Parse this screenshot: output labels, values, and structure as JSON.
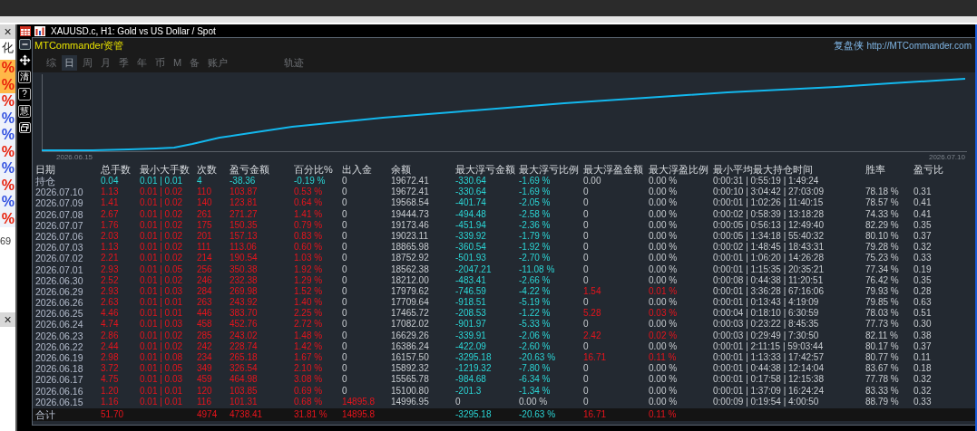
{
  "left_panel": {
    "close": "×",
    "label": "化",
    "items": [
      {
        "text": "%",
        "color": "#e8200a",
        "highlight": true
      },
      {
        "text": "%",
        "color": "#e8200a",
        "highlight": true
      },
      {
        "text": "%",
        "color": "#e8200a",
        "highlight": false
      },
      {
        "text": "%",
        "color": "#3050e0",
        "highlight": false
      },
      {
        "text": "%",
        "color": "#3050e0",
        "highlight": false
      },
      {
        "text": "%",
        "color": "#e8200a",
        "highlight": false
      },
      {
        "text": "%",
        "color": "#3050e0",
        "highlight": false
      },
      {
        "text": "%",
        "color": "#e8200a",
        "highlight": false
      },
      {
        "text": "%",
        "color": "#3050e0",
        "highlight": false
      },
      {
        "text": "%",
        "color": "#e8200a",
        "highlight": false
      }
    ],
    "value": "69",
    "close_2": "×"
  },
  "tools": [
    {
      "kind": "minus"
    },
    {
      "kind": "move"
    },
    {
      "kind": "text",
      "label": "清"
    },
    {
      "kind": "text",
      "label": "?"
    },
    {
      "kind": "text",
      "label": "慧"
    },
    {
      "kind": "window"
    }
  ],
  "window": {
    "title": "XAUUSD.c, H1:  Gold vs US Dollar / Spot"
  },
  "panel": {
    "title": "MTCommander资管",
    "brand": "复盘侠",
    "url": "http://MTCommander.com"
  },
  "tabs": [
    {
      "label": "综",
      "selected": false
    },
    {
      "label": "日",
      "selected": true
    },
    {
      "label": "周",
      "selected": false
    },
    {
      "label": "月",
      "selected": false
    },
    {
      "label": "季",
      "selected": false
    },
    {
      "label": "年",
      "selected": false
    },
    {
      "label": "币",
      "selected": false
    },
    {
      "label": "M",
      "selected": false
    },
    {
      "label": "备",
      "selected": false
    },
    {
      "label": "账户",
      "selected": false
    }
  ],
  "track_button": {
    "label": "轨迹"
  },
  "equity_chart": {
    "start_label": "2026.06.15",
    "end_label": "2026.07.10"
  },
  "table": {
    "columns": [
      "日期",
      "总手数",
      "最小大手数",
      "次数",
      "盈亏金额",
      "百分比%",
      "出入金",
      "余额",
      "最大浮亏金额",
      "最大浮亏比例",
      "最大浮盈金额",
      "最大浮盈比例",
      "最小平均最大持仓时间",
      "胜率",
      "盈亏比"
    ],
    "rows": [
      {
        "kind": "holding",
        "cash_flow": false,
        "float_loss": true,
        "float_gain": false,
        "cells": [
          "持仓",
          "0.04",
          "0.01 | 0.01",
          "4",
          "-38.36",
          "-0.19 %",
          "0",
          "19672.41",
          "-330.64",
          "-1.69 %",
          "0.00",
          "0.00 %",
          "0:00:31 | 0:55:19 | 1:49:24",
          null,
          null
        ]
      },
      {
        "kind": "day",
        "cash_flow": false,
        "float_loss": true,
        "float_gain": false,
        "cells": [
          "2026.07.10",
          "1.13",
          "0.01 | 0.02",
          "110",
          "103.87",
          "0.53 %",
          "0",
          "19672.41",
          "-330.64",
          "-1.69 %",
          "0",
          "0.00 %",
          "0:00:10 | 3:04:42 | 27:03:09",
          "78.18 %",
          "0.31"
        ]
      },
      {
        "kind": "day",
        "cash_flow": false,
        "float_loss": true,
        "float_gain": false,
        "cells": [
          "2026.07.09",
          "1.41",
          "0.01 | 0.02",
          "140",
          "123.81",
          "0.64 %",
          "0",
          "19568.54",
          "-401.74",
          "-2.05 %",
          "0",
          "0.00 %",
          "0:00:01 | 1:02:26 | 11:40:15",
          "78.57 %",
          "0.41"
        ]
      },
      {
        "kind": "day",
        "cash_flow": false,
        "float_loss": true,
        "float_gain": false,
        "cells": [
          "2026.07.08",
          "2.67",
          "0.01 | 0.02",
          "261",
          "271.27",
          "1.41 %",
          "0",
          "19444.73",
          "-494.48",
          "-2.58 %",
          "0",
          "0.00 %",
          "0:00:02 | 0:58:39 | 13:18:28",
          "74.33 %",
          "0.41"
        ]
      },
      {
        "kind": "day",
        "cash_flow": false,
        "float_loss": true,
        "float_gain": false,
        "cells": [
          "2026.07.07",
          "1.76",
          "0.01 | 0.02",
          "175",
          "150.35",
          "0.79 %",
          "0",
          "19173.46",
          "-451.94",
          "-2.36 %",
          "0",
          "0.00 %",
          "0:00:05 | 0:56:13 | 12:49:40",
          "82.29 %",
          "0.35"
        ]
      },
      {
        "kind": "day",
        "cash_flow": false,
        "float_loss": true,
        "float_gain": false,
        "cells": [
          "2026.07.06",
          "2.03",
          "0.01 | 0.02",
          "201",
          "157.13",
          "0.83 %",
          "0",
          "19023.11",
          "-339.92",
          "-1.79 %",
          "0",
          "0.00 %",
          "0:00:05 | 1:34:18 | 55:40:32",
          "80.10 %",
          "0.37"
        ]
      },
      {
        "kind": "day",
        "cash_flow": false,
        "float_loss": true,
        "float_gain": false,
        "cells": [
          "2026.07.03",
          "1.13",
          "0.01 | 0.02",
          "111",
          "113.06",
          "0.60 %",
          "0",
          "18865.98",
          "-360.54",
          "-1.92 %",
          "0",
          "0.00 %",
          "0:00:02 | 1:48:45 | 18:43:31",
          "79.28 %",
          "0.32"
        ]
      },
      {
        "kind": "day",
        "cash_flow": false,
        "float_loss": true,
        "float_gain": false,
        "cells": [
          "2026.07.02",
          "2.21",
          "0.01 | 0.02",
          "214",
          "190.54",
          "1.03 %",
          "0",
          "18752.92",
          "-501.93",
          "-2.70 %",
          "0",
          "0.00 %",
          "0:00:01 | 1:06:20 | 14:26:28",
          "75.23 %",
          "0.33"
        ]
      },
      {
        "kind": "day",
        "cash_flow": false,
        "float_loss": true,
        "float_gain": false,
        "cells": [
          "2026.07.01",
          "2.93",
          "0.01 | 0.05",
          "256",
          "350.38",
          "1.92 %",
          "0",
          "18562.38",
          "-2047.21",
          "-11.08 %",
          "0",
          "0.00 %",
          "0:00:01 | 1:15:35 | 20:35:21",
          "77.34 %",
          "0.19"
        ]
      },
      {
        "kind": "day",
        "cash_flow": false,
        "float_loss": true,
        "float_gain": false,
        "cells": [
          "2026.06.30",
          "2.52",
          "0.01 | 0.02",
          "246",
          "232.38",
          "1.29 %",
          "0",
          "18212.00",
          "-483.41",
          "-2.66 %",
          "0",
          "0.00 %",
          "0:00:08 | 0:44:38 | 11:20:51",
          "76.42 %",
          "0.35"
        ]
      },
      {
        "kind": "day",
        "cash_flow": false,
        "float_loss": true,
        "float_gain": true,
        "cells": [
          "2026.06.29",
          "2.93",
          "0.01 | 0.03",
          "284",
          "269.98",
          "1.52 %",
          "0",
          "17979.62",
          "-746.59",
          "-4.22 %",
          "1.54",
          "0.01 %",
          "0:00:01 | 3:36:28 | 67:16:06",
          "79.93 %",
          "0.28"
        ]
      },
      {
        "kind": "day",
        "cash_flow": false,
        "float_loss": true,
        "float_gain": false,
        "cells": [
          "2026.06.26",
          "2.63",
          "0.01 | 0.01",
          "263",
          "243.92",
          "1.40 %",
          "0",
          "17709.64",
          "-918.51",
          "-5.19 %",
          "0",
          "0.00 %",
          "0:00:01 | 0:13:43 | 4:19:09",
          "79.85 %",
          "0.63"
        ]
      },
      {
        "kind": "day",
        "cash_flow": false,
        "float_loss": true,
        "float_gain": true,
        "cells": [
          "2026.06.25",
          "4.46",
          "0.01 | 0.01",
          "446",
          "383.70",
          "2.25 %",
          "0",
          "17465.72",
          "-208.53",
          "-1.22 %",
          "5.28",
          "0.03 %",
          "0:00:04 | 0:18:10 | 6:30:59",
          "78.03 %",
          "0.51"
        ]
      },
      {
        "kind": "day",
        "cash_flow": false,
        "float_loss": true,
        "float_gain": false,
        "cells": [
          "2026.06.24",
          "4.74",
          "0.01 | 0.03",
          "458",
          "452.76",
          "2.72 %",
          "0",
          "17082.02",
          "-901.97",
          "-5.33 %",
          "0",
          "0.00 %",
          "0:00:03 | 0:23:22 | 8:45:35",
          "77.73 %",
          "0.30"
        ]
      },
      {
        "kind": "day",
        "cash_flow": false,
        "float_loss": true,
        "float_gain": true,
        "cells": [
          "2026.06.23",
          "2.86",
          "0.01 | 0.02",
          "285",
          "243.02",
          "1.48 %",
          "0",
          "16629.26",
          "-339.91",
          "-2.06 %",
          "2.42",
          "0.02 %",
          "0:00:03 | 0:29:49 | 7:30:50",
          "82.11 %",
          "0.38"
        ]
      },
      {
        "kind": "day",
        "cash_flow": false,
        "float_loss": true,
        "float_gain": false,
        "cells": [
          "2026.06.22",
          "2.44",
          "0.01 | 0.02",
          "242",
          "228.74",
          "1.42 %",
          "0",
          "16386.24",
          "-422.09",
          "-2.60 %",
          "0",
          "0.00 %",
          "0:00:01 | 2:11:15 | 59:03:44",
          "80.17 %",
          "0.37"
        ]
      },
      {
        "kind": "day",
        "cash_flow": false,
        "float_loss": true,
        "float_gain": true,
        "cells": [
          "2026.06.19",
          "2.98",
          "0.01 | 0.08",
          "234",
          "265.18",
          "1.67 %",
          "0",
          "16157.50",
          "-3295.18",
          "-20.63 %",
          "16.71",
          "0.11 %",
          "0:00:01 | 1:13:33 | 17:42:57",
          "80.77 %",
          "0.11"
        ]
      },
      {
        "kind": "day",
        "cash_flow": false,
        "float_loss": true,
        "float_gain": false,
        "cells": [
          "2026.06.18",
          "3.72",
          "0.01 | 0.05",
          "349",
          "326.54",
          "2.10 %",
          "0",
          "15892.32",
          "-1219.32",
          "-7.80 %",
          "0",
          "0.00 %",
          "0:00:01 | 0:44:38 | 12:14:04",
          "83.67 %",
          "0.18"
        ]
      },
      {
        "kind": "day",
        "cash_flow": false,
        "float_loss": true,
        "float_gain": false,
        "cells": [
          "2026.06.17",
          "4.75",
          "0.01 | 0.03",
          "459",
          "464.98",
          "3.08 %",
          "0",
          "15565.78",
          "-984.68",
          "-6.34 %",
          "0",
          "0.00 %",
          "0:00:01 | 0:17:58 | 12:15:38",
          "77.78 %",
          "0.32"
        ]
      },
      {
        "kind": "day",
        "cash_flow": false,
        "float_loss": true,
        "float_gain": false,
        "cells": [
          "2026.06.16",
          "1.20",
          "0.01 | 0.01",
          "120",
          "103.85",
          "0.69 %",
          "0",
          "15100.80",
          "-201.3",
          "-1.34 %",
          "0",
          "0.00 %",
          "0:00:01 | 1:37:09 | 16:24:24",
          "83.33 %",
          "0.32"
        ]
      },
      {
        "kind": "day",
        "cash_flow": true,
        "float_loss": false,
        "float_gain": false,
        "cells": [
          "2026.06.15",
          "1.16",
          "0.01 | 0.01",
          "116",
          "101.31",
          "0.68 %",
          "14895.8",
          "14996.95",
          "0",
          "0.00 %",
          "0",
          "0.00 %",
          "0:00:09 | 0:19:54 | 4:00:50",
          "88.79 %",
          "0.33"
        ]
      },
      {
        "kind": "total",
        "cash_flow": true,
        "float_loss": true,
        "float_gain": true,
        "cells": [
          "合计",
          "51.70",
          null,
          "4974",
          "4738.41",
          "31.81 %",
          "14895.8",
          null,
          "-3295.18",
          "-20.63 %",
          "16.71",
          "0.11 %",
          null,
          null,
          null
        ]
      }
    ]
  }
}
